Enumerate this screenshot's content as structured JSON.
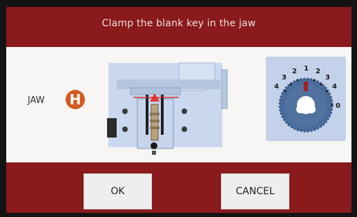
{
  "header": {
    "title": "Clamp the blank key in the jaw"
  },
  "jaw": {
    "label": "JAW",
    "code": "H"
  },
  "dial": {
    "numbers": [
      "4",
      "3",
      "2",
      "1",
      "2",
      "3",
      "4",
      "0"
    ]
  },
  "buttons": {
    "ok_label": "OK",
    "cancel_label": "CANCEL"
  }
}
